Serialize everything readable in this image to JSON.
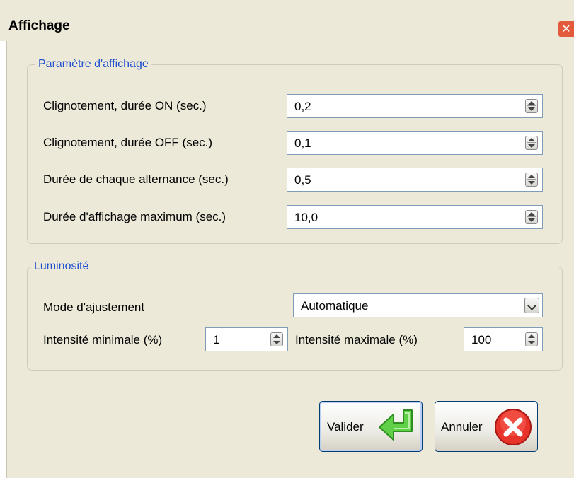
{
  "window": {
    "title": "Affichage",
    "close_glyph": "✕"
  },
  "display_group": {
    "legend": "Paramètre d'affichage",
    "rows": [
      {
        "label": "Clignotement, durée ON (sec.)",
        "value": "0,2"
      },
      {
        "label": "Clignotement, durée OFF (sec.)",
        "value": "0,1"
      },
      {
        "label": "Durée de chaque alternance (sec.)",
        "value": "0,5"
      },
      {
        "label": "Durée d'affichage maximum (sec.)",
        "value": "10,0"
      }
    ]
  },
  "brightness_group": {
    "legend": "Luminosité",
    "mode_label": "Mode d'ajustement",
    "mode_value": "Automatique",
    "min_label": "Intensité minimale (%)",
    "min_value": "1",
    "max_label": "Intensité maximale (%)",
    "max_value": "100"
  },
  "buttons": {
    "validate_label": "Valider",
    "cancel_label": "Annuler"
  },
  "colors": {
    "background": "#ece9d8",
    "legend_text": "#1f4fcf",
    "field_border": "#7f9db9",
    "validate_icon": "#4cc23a",
    "cancel_icon": "#e8332b"
  },
  "icons": {
    "validate": "green-enter-arrow-icon",
    "cancel": "red-x-circle-icon",
    "close": "close-icon"
  }
}
